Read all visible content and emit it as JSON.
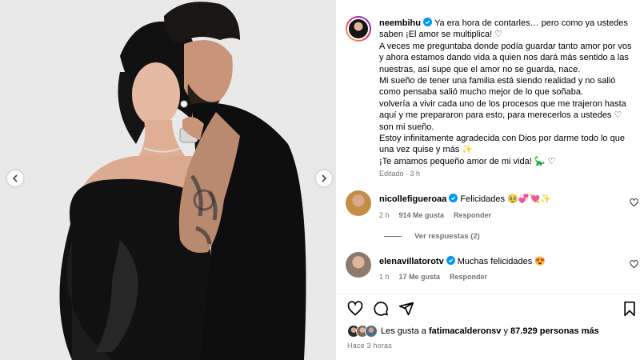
{
  "post": {
    "author": "neembihu",
    "caption_lines": [
      "Ya era hora de contarles… pero como ya ustedes saben ¡El amor se multiplica! ♡",
      "A veces me preguntaba donde podía guardar tanto amor por vos y ahora estamos dando vida a quien nos dará más sentido a las nuestras, así supe que el amor no se guarda, nace.",
      "Mi sueño de tener una familia está siendo realidad y no salió como pensaba salió mucho mejor de lo que soñaba.",
      "volvería a vivir cada uno de los procesos que me trajeron hasta aquí y me prepararon para esto, para merecerlos a ustedes ♡ son mi sueño.",
      "Estoy infinitamente agradecida con Dios por darme todo lo que una vez quise y más ✨",
      "¡Te amamos pequeño amor de mi vida! 🦕 ♡"
    ],
    "edited": "Editado",
    "edited_time": "3 h"
  },
  "comments": [
    {
      "user": "nicollefigueroaa",
      "text": "Felicidades 🥹💞💘✨",
      "time": "2 h",
      "likes": "914 Me gusta",
      "reply": "Responder",
      "view_replies": "Ver respuestas (2)"
    },
    {
      "user": "elenavillatorotv",
      "text": "Muchas felicidades 😍",
      "time": "1 h",
      "likes": "17 Me gusta",
      "reply": "Responder"
    }
  ],
  "likes": {
    "prefix": "Les gusta a",
    "user": "fatimacalderonsv",
    "middle": "y",
    "count": "87.929 personas más"
  },
  "posted_ago": "Hace 3 horas",
  "icons": {
    "like": "heart-icon",
    "comment": "comment-icon",
    "share": "share-icon",
    "save": "bookmark-icon",
    "verified": "verified-badge-icon"
  },
  "colors": {
    "verified": "#0095f6",
    "muted": "#737373",
    "divider": "#efefef"
  }
}
